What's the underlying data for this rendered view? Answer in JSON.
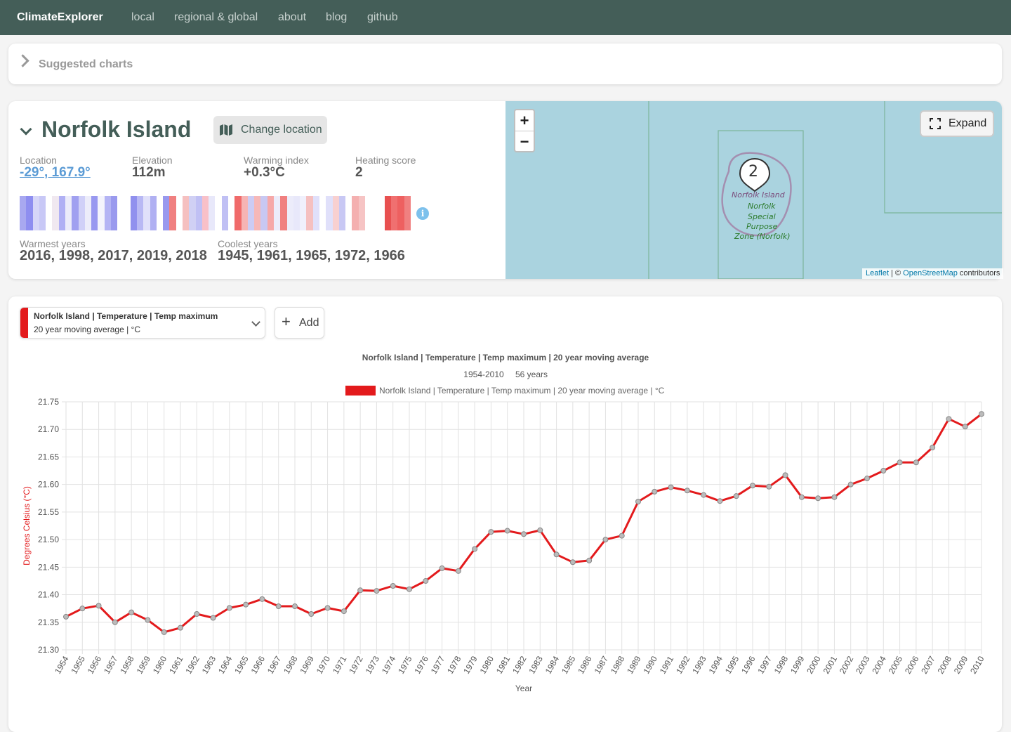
{
  "nav": {
    "brand": "ClimateExplorer",
    "links": [
      "local",
      "regional & global",
      "about",
      "blog",
      "github"
    ]
  },
  "suggested": {
    "label": "Suggested charts"
  },
  "location": {
    "name": "Norfolk Island",
    "change_label": "Change location",
    "stats": [
      {
        "label": "Location",
        "value": "-29°, 167.9°"
      },
      {
        "label": "Elevation",
        "value": "112m"
      },
      {
        "label": "Warming index",
        "value": "+0.3°C"
      },
      {
        "label": "Heating score",
        "value": "2"
      }
    ],
    "info_glyph": "i",
    "warmest_label": "Warmest years",
    "warmest_value": "2016, 1998, 2017, 2019, 2018",
    "coolest_label": "Coolest years",
    "coolest_value": "1945, 1961, 1965, 1972, 1966",
    "stripes": [
      "#a8a8f0",
      "#8e8ef0",
      "#d6d6f8",
      "#c8c8f6",
      "#ffffff",
      "#f0e8f0",
      "#b0b0f4",
      "#ececfa",
      "#a0a0f0",
      "#d0d0f8",
      "#ececfa",
      "#9898f0",
      "#f4f4fc",
      "#b4b4f4",
      "#9a9aee",
      "#ffffff",
      "#ffffff",
      "#9090ee",
      "#b8b8f4",
      "#e0e0fa",
      "#b0b0f2",
      "#ffffff",
      "#9898ee",
      "#f08080",
      "#ffffff",
      "#f5c0c0",
      "#d0d0f4",
      "#c0c0f4",
      "#f8c0c8",
      "#e8e8fa",
      "#ffffff",
      "#c0c0f4",
      "#ffffff",
      "#f06a6a",
      "#f6b4b4",
      "#ccccf4",
      "#f6b8b8",
      "#c8c8f2",
      "#f6a8a8",
      "#ececfa",
      "#f08080",
      "#ececfa",
      "#e8e8fa",
      "#f0f0fc",
      "#f5c0c0",
      "#e0e0fa",
      "#ffffff",
      "#e0e0fa",
      "#f8d0d0",
      "#c8c8f4",
      "#ffffff",
      "#f4b0b0",
      "#f6c4c4",
      "#ffffff",
      "#ffffff",
      "#ffffff",
      "#e85050",
      "#f07070",
      "#ee6060",
      "#f08080"
    ]
  },
  "map": {
    "zoom_in": "+",
    "zoom_out": "−",
    "expand_label": "Expand",
    "cluster_count": "2",
    "labels": [
      "Norfolk Island",
      "Norfolk",
      "Special",
      "Purpose",
      "Zone (Norfolk)"
    ],
    "attribution_leaflet": "Leaflet",
    "attribution_sep": " | © ",
    "attribution_osm": "OpenStreetMap",
    "attribution_tail": " contributors"
  },
  "series_select": {
    "title": "Norfolk Island | Temperature | Temp maximum",
    "subtitle": "20 year moving average | °C",
    "color": "#e31a1c"
  },
  "add_button": {
    "plus": "+",
    "label": "Add"
  },
  "chart_data": {
    "type": "line",
    "title": "Norfolk Island | Temperature | Temp maximum | 20 year moving average",
    "subtitle_range": "1954-2010",
    "subtitle_years": "56 years",
    "xlabel": "Year",
    "ylabel": "Degrees Celsius (°C)",
    "ylim": [
      21.3,
      21.75
    ],
    "yticks": [
      "21.30",
      "21.35",
      "21.40",
      "21.45",
      "21.50",
      "21.55",
      "21.60",
      "21.65",
      "21.70",
      "21.75"
    ],
    "x": [
      "1954",
      "1955",
      "1956",
      "1957",
      "1958",
      "1959",
      "1960",
      "1961",
      "1962",
      "1963",
      "1964",
      "1965",
      "1966",
      "1967",
      "1968",
      "1969",
      "1970",
      "1971",
      "1972",
      "1973",
      "1974",
      "1975",
      "1976",
      "1977",
      "1978",
      "1979",
      "1980",
      "1981",
      "1982",
      "1983",
      "1984",
      "1985",
      "1986",
      "1987",
      "1988",
      "1989",
      "1990",
      "1991",
      "1992",
      "1993",
      "1994",
      "1995",
      "1996",
      "1997",
      "1998",
      "1999",
      "2000",
      "2001",
      "2002",
      "2003",
      "2004",
      "2005",
      "2006",
      "2007",
      "2008",
      "2009",
      "2010"
    ],
    "series": [
      {
        "name": "Norfolk Island | Temperature | Temp maximum | 20 year moving average | °C",
        "color": "#e31a1c",
        "values": [
          21.36,
          21.375,
          21.38,
          21.35,
          21.368,
          21.354,
          21.332,
          21.34,
          21.365,
          21.358,
          21.376,
          21.382,
          21.392,
          21.379,
          21.379,
          21.365,
          21.376,
          21.37,
          21.408,
          21.407,
          21.416,
          21.41,
          21.425,
          21.448,
          21.443,
          21.483,
          21.514,
          21.516,
          21.51,
          21.517,
          21.473,
          21.459,
          21.462,
          21.5,
          21.507,
          21.569,
          21.587,
          21.595,
          21.589,
          21.581,
          21.57,
          21.579,
          21.598,
          21.596,
          21.617,
          21.577,
          21.575,
          21.577,
          21.6,
          21.611,
          21.625,
          21.64,
          21.64,
          21.667,
          21.719,
          21.705,
          21.728
        ]
      }
    ],
    "grid": true,
    "legend_position": "top"
  }
}
